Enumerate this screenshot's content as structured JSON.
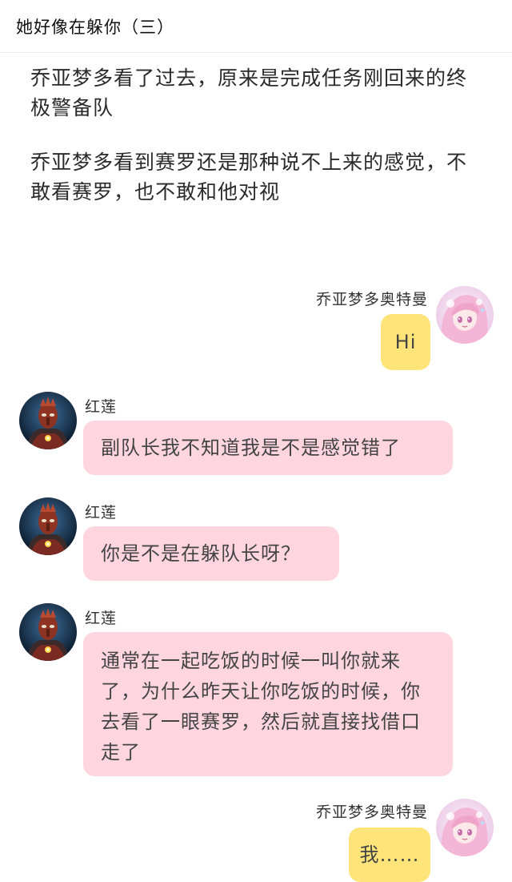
{
  "header": {
    "title": "她好像在躲你（三）"
  },
  "narration": [
    "乔亚梦多看了过去，原来是完成任务刚回来的终极警备队",
    "乔亚梦多看到赛罗还是那种说不上来的感觉，不敢看赛罗，也不敢和他对视"
  ],
  "messages": [
    {
      "sender": "乔亚梦多奥特曼",
      "text": "Hi"
    },
    {
      "sender": "红莲",
      "text": "副队长我不知道我是不是感觉错了"
    },
    {
      "sender": "红莲",
      "text": "你是不是在躲队长呀？"
    },
    {
      "sender": "红莲",
      "text": "通常在一起吃饭的时候一叫你就来了，为什么昨天让你吃饭的时候，你去看了一眼赛罗，然后就直接找借口走了"
    },
    {
      "sender": "乔亚梦多奥特曼",
      "text": "我……"
    }
  ],
  "colors": {
    "pink_bubble": "#ffd6e0",
    "yellow_bubble": "#ffe47a"
  },
  "icons": {
    "self_avatar": "anime-girl-avatar",
    "other_avatar": "armored-hero-avatar"
  }
}
